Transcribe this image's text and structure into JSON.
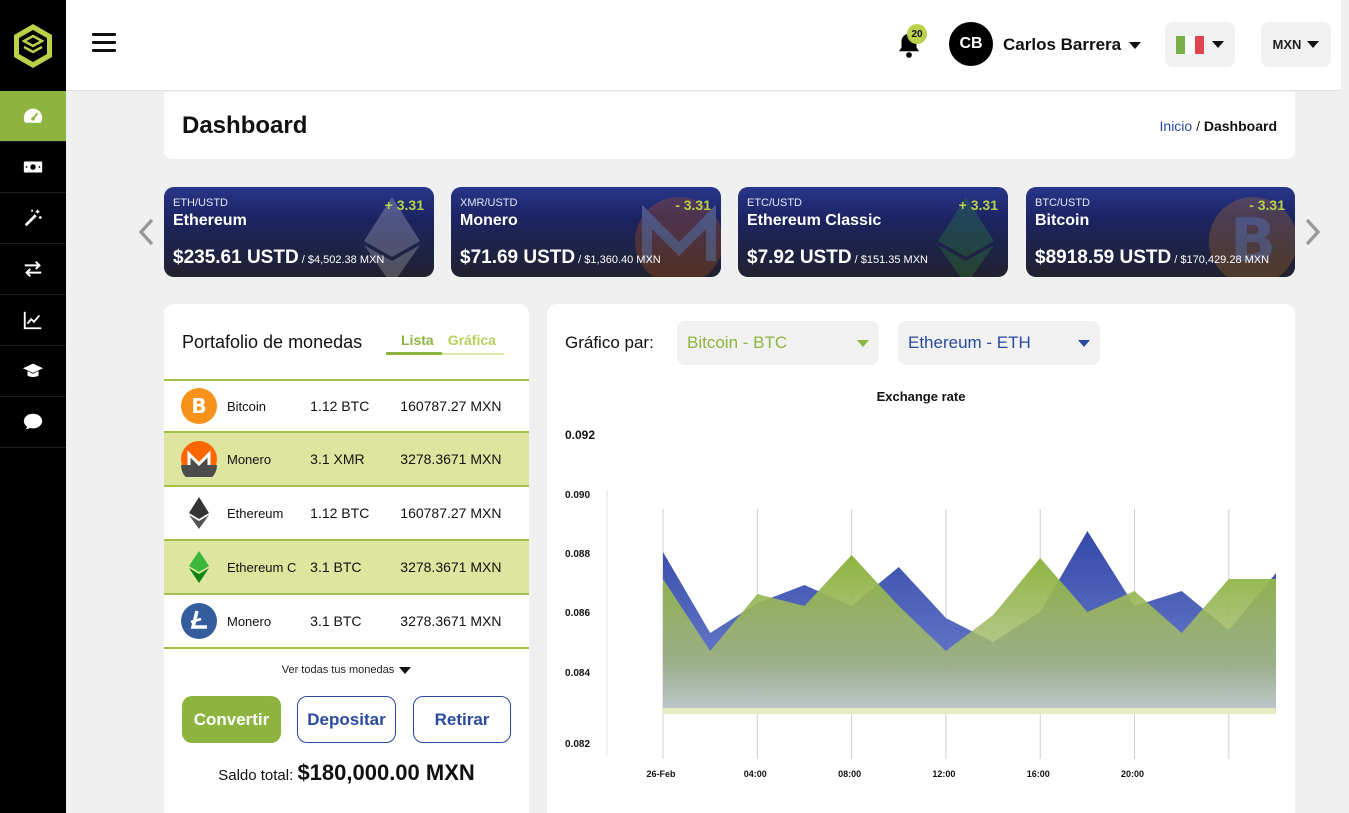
{
  "sidebar": {
    "items": [
      {
        "icon": "speedometer-icon",
        "active": true
      },
      {
        "icon": "money-icon",
        "active": false
      },
      {
        "icon": "magic-wand-icon",
        "active": false
      },
      {
        "icon": "exchange-arrows-icon",
        "active": false
      },
      {
        "icon": "line-chart-icon",
        "active": false
      },
      {
        "icon": "graduation-cap-icon",
        "active": false
      },
      {
        "icon": "chat-bubble-icon",
        "active": false
      }
    ]
  },
  "topbar": {
    "notifications": "20",
    "avatar_initials": "CB",
    "user_name": "Carlos Barrera",
    "currency": "MXN"
  },
  "header": {
    "title": "Dashboard",
    "breadcrumb_home": "Inicio",
    "breadcrumb_sep": " / ",
    "breadcrumb_current": "Dashboard"
  },
  "tickers": [
    {
      "pair": "ETH/USTD",
      "name": "Ethereum",
      "change": "+ 3.31",
      "price": "$235.61 USTD",
      "mxn": " / $4,502.38 MXN"
    },
    {
      "pair": "XMR/USTD",
      "name": "Monero",
      "change": "- 3.31",
      "price": "$71.69 USTD",
      "mxn": " / $1,360.40 MXN"
    },
    {
      "pair": "ETC/USTD",
      "name": "Ethereum Classic",
      "change": "+ 3.31",
      "price": "$7.92 USTD",
      "mxn": " / $151.35 MXN"
    },
    {
      "pair": "BTC/USTD",
      "name": "Bitcoin",
      "change": "- 3.31",
      "price": "$8918.59 USTD",
      "mxn": " / $170,429.28 MXN"
    }
  ],
  "portfolio": {
    "title": "Portafolio de monedas",
    "tab_list": "Lista",
    "tab_chart": "Gráfica",
    "coins": [
      {
        "name": "Bitcoin",
        "amount": "1.12 BTC",
        "value": "160787.27  MXN",
        "icon": "bitcoin-icon"
      },
      {
        "name": "Monero",
        "amount": "3.1 XMR",
        "value": "3278.3671  MXN",
        "icon": "monero-icon"
      },
      {
        "name": "Ethereum",
        "amount": "1.12 BTC",
        "value": "160787.27  MXN",
        "icon": "ethereum-icon"
      },
      {
        "name": "Ethereum C",
        "amount": "3.1 BTC",
        "value": "3278.3671  MXN",
        "icon": "ethereum-classic-icon"
      },
      {
        "name": "Monero",
        "amount": "3.1 BTC",
        "value": "3278.3671  MXN",
        "icon": "litecoin-icon"
      }
    ],
    "see_all": "Ver todas tus monedas",
    "btn_convert": "Convertir",
    "btn_deposit": "Depositar",
    "btn_withdraw": "Retirar",
    "balance_label": "Saldo total: ",
    "balance_amount": "$180,000.00 MXN"
  },
  "chart": {
    "label": "Gráfico par:",
    "pair_a": "Bitcoin - BTC",
    "pair_b": "Ethereum - ETH"
  },
  "colors": {
    "accent_green": "#8db43e",
    "brand_blue": "#2a4aa0",
    "sidebar_bg": "#000000"
  },
  "chart_data": {
    "type": "area",
    "title": "Exchange rate",
    "xlabel": "",
    "ylabel": "",
    "x_ticks": [
      "26-Feb",
      "04:00",
      "08:00",
      "12:00",
      "16:00",
      "20:00"
    ],
    "y_ticks": [
      "0.092",
      "0.090",
      "0.088",
      "0.086",
      "0.084",
      "0.082"
    ],
    "ylim": [
      0.082,
      0.092
    ],
    "grid": true,
    "series": [
      {
        "color": "#3e55b0",
        "values": [
          0.088,
          0.0853,
          0.0863,
          0.0869,
          0.0862,
          0.0875,
          0.0858,
          0.085,
          0.086,
          0.0887,
          0.0862,
          0.0867,
          0.0854,
          0.0873
        ]
      },
      {
        "color": "#8db43e",
        "values": [
          0.0871,
          0.0847,
          0.0866,
          0.0862,
          0.0879,
          0.0862,
          0.0847,
          0.0859,
          0.0878,
          0.086,
          0.0867,
          0.0853,
          0.0871,
          0.0871
        ]
      }
    ]
  }
}
